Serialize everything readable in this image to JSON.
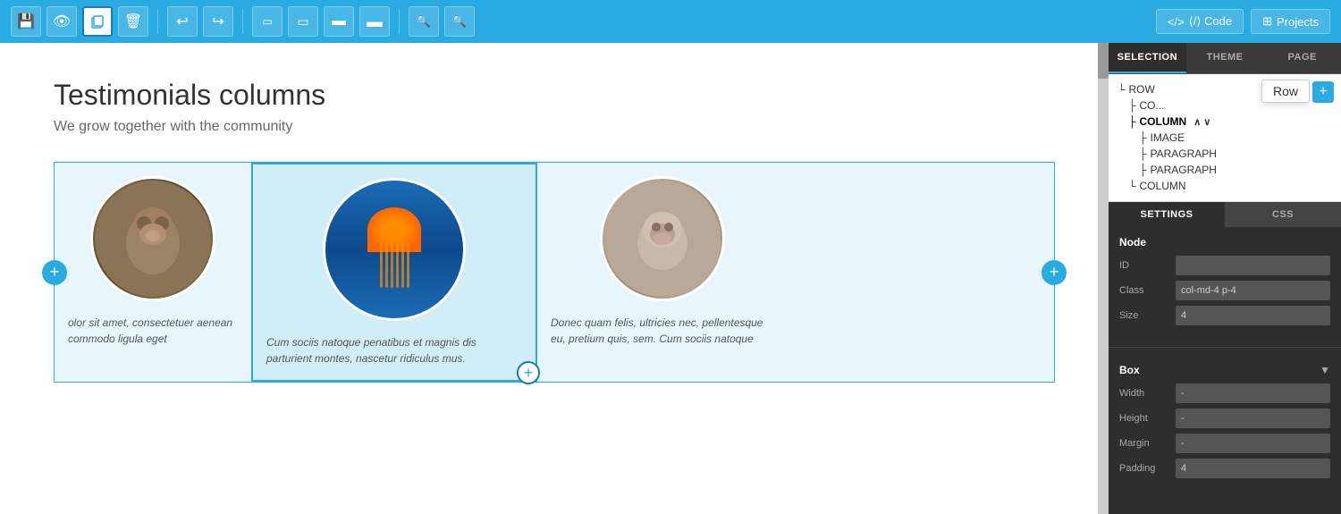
{
  "toolbar": {
    "buttons": [
      {
        "id": "save",
        "label": "💾",
        "active": false
      },
      {
        "id": "preview",
        "label": "👁",
        "active": false
      },
      {
        "id": "copy",
        "label": "📋",
        "active": true
      },
      {
        "id": "delete",
        "label": "🗑",
        "active": false
      }
    ],
    "history": [
      {
        "id": "undo",
        "label": "↩"
      },
      {
        "id": "redo",
        "label": "↪"
      }
    ],
    "device": [
      {
        "id": "mobile-sm",
        "label": "▭"
      },
      {
        "id": "mobile",
        "label": "▭"
      },
      {
        "id": "tablet",
        "label": "▬"
      },
      {
        "id": "desktop",
        "label": "▬"
      }
    ],
    "zoom": [
      {
        "id": "zoom-out",
        "label": "🔍-"
      },
      {
        "id": "zoom-in",
        "label": "🔍+"
      }
    ],
    "right_buttons": [
      {
        "id": "code",
        "label": "⟨/⟩ Code"
      },
      {
        "id": "projects",
        "label": "⊞ Projects"
      }
    ]
  },
  "page": {
    "title": "Testimonials columns",
    "subtitle": "We grow together with the community"
  },
  "columns": [
    {
      "id": "col-1",
      "text": "olor sit amet, consectetuer\naenean commodo ligula eget",
      "selected": false,
      "has_plus_left": true
    },
    {
      "id": "col-2",
      "text": "Cum sociis natoque penatibus et magnis dis parturient montes, nascetur ridiculus mus.",
      "selected": true,
      "has_plus_right": true
    },
    {
      "id": "col-3",
      "text": "Donec quam felis, ultricies nec, pellentesque eu, pretium quis, sem. Cum sociis natoque",
      "selected": false
    }
  ],
  "tree": {
    "items": [
      {
        "label": "ROW",
        "level": 0,
        "selected": false
      },
      {
        "label": "CO...",
        "level": 1,
        "selected": false
      },
      {
        "label": "COLUMN",
        "level": 1,
        "selected": true,
        "has_arrows": true
      },
      {
        "label": "IMAGE",
        "level": 2,
        "selected": false
      },
      {
        "label": "PARAGRAPH",
        "level": 2,
        "selected": false
      },
      {
        "label": "PARAGRAPH",
        "level": 2,
        "selected": false
      },
      {
        "label": "COLUMN",
        "level": 1,
        "selected": false
      }
    ],
    "tooltip": "Row",
    "add_button_label": "+"
  },
  "panel": {
    "tabs": [
      {
        "label": "SELECTION",
        "active": true
      },
      {
        "label": "THEME",
        "active": false
      },
      {
        "label": "PAGE",
        "active": false
      }
    ],
    "settings_tabs": [
      {
        "label": "SETTINGS",
        "active": true
      },
      {
        "label": "CSS",
        "active": false
      }
    ],
    "node_section": {
      "title": "Node",
      "fields": [
        {
          "label": "ID",
          "value": ""
        },
        {
          "label": "Class",
          "value": "col-md-4 p-4"
        },
        {
          "label": "Size",
          "value": "4"
        }
      ]
    },
    "box_section": {
      "title": "Box",
      "fields": [
        {
          "label": "Width",
          "value": "-"
        },
        {
          "label": "Height",
          "value": "-"
        },
        {
          "label": "Margin",
          "value": "-"
        },
        {
          "label": "Padding",
          "value": "4"
        }
      ]
    }
  }
}
